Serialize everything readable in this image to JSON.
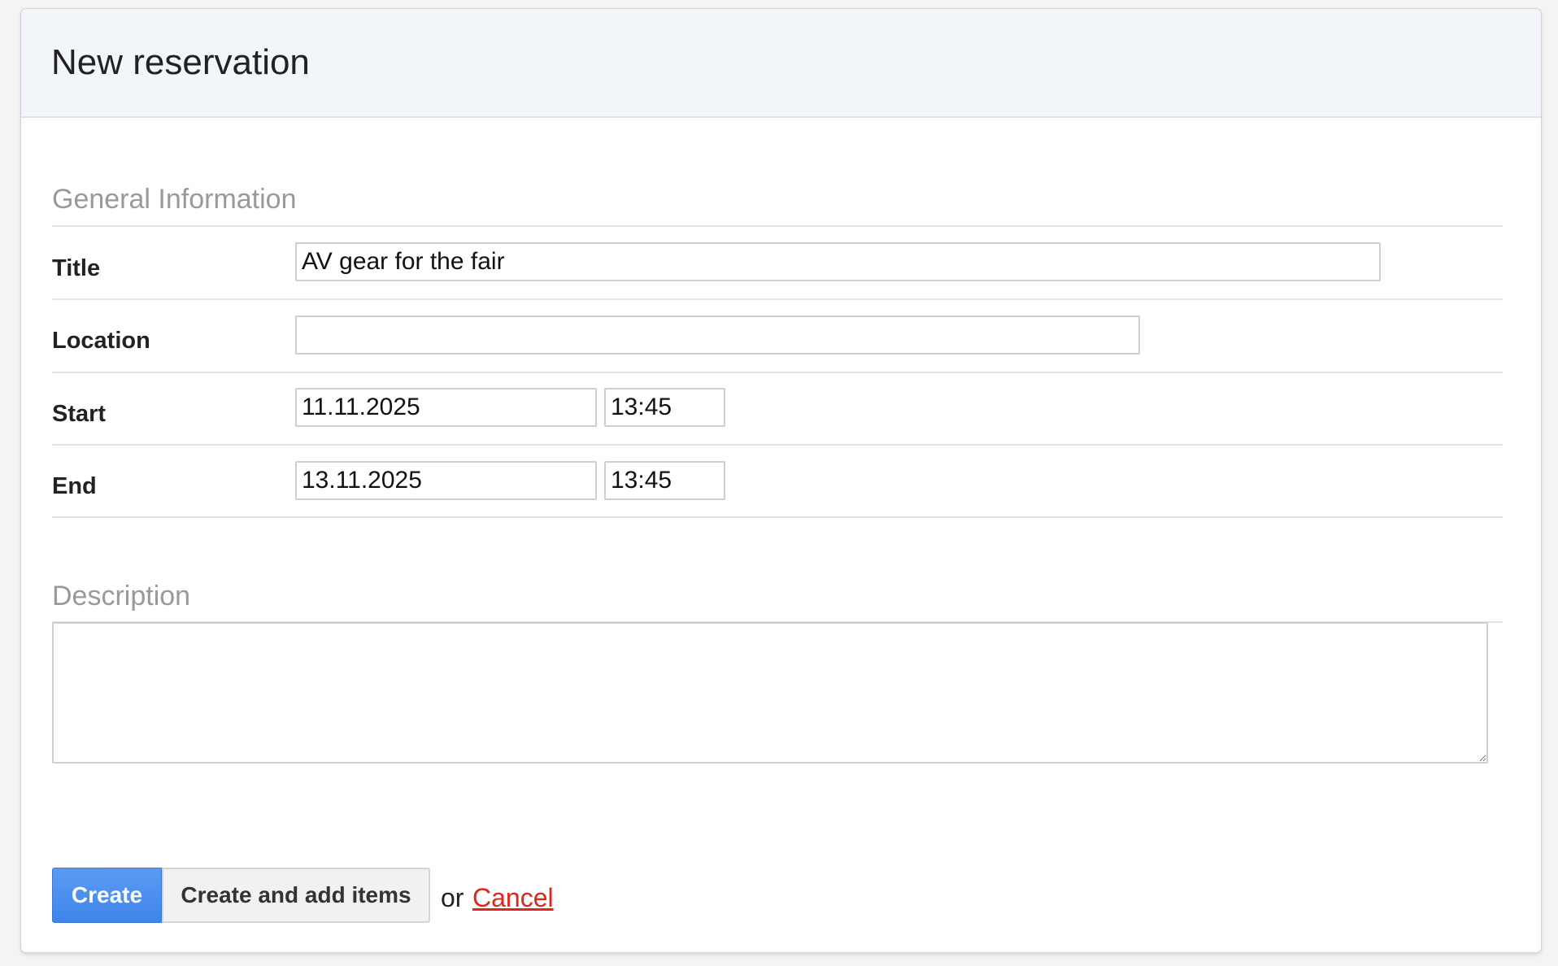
{
  "header": {
    "title": "New reservation"
  },
  "general": {
    "section_title": "General Information",
    "title_label": "Title",
    "title_value": "AV gear for the fair",
    "location_label": "Location",
    "location_value": "",
    "start_label": "Start",
    "start_date": "11.11.2025",
    "start_time": "13:45",
    "end_label": "End",
    "end_date": "13.11.2025",
    "end_time": "13:45"
  },
  "description": {
    "section_title": "Description",
    "value": ""
  },
  "actions": {
    "create_label": "Create",
    "create_add_items_label": "Create and add items",
    "or_text": "or",
    "cancel_label": "Cancel"
  },
  "colors": {
    "primary_button": "#4a8eef",
    "cancel_link": "#e0251b",
    "header_background": "#f2f5f9"
  }
}
